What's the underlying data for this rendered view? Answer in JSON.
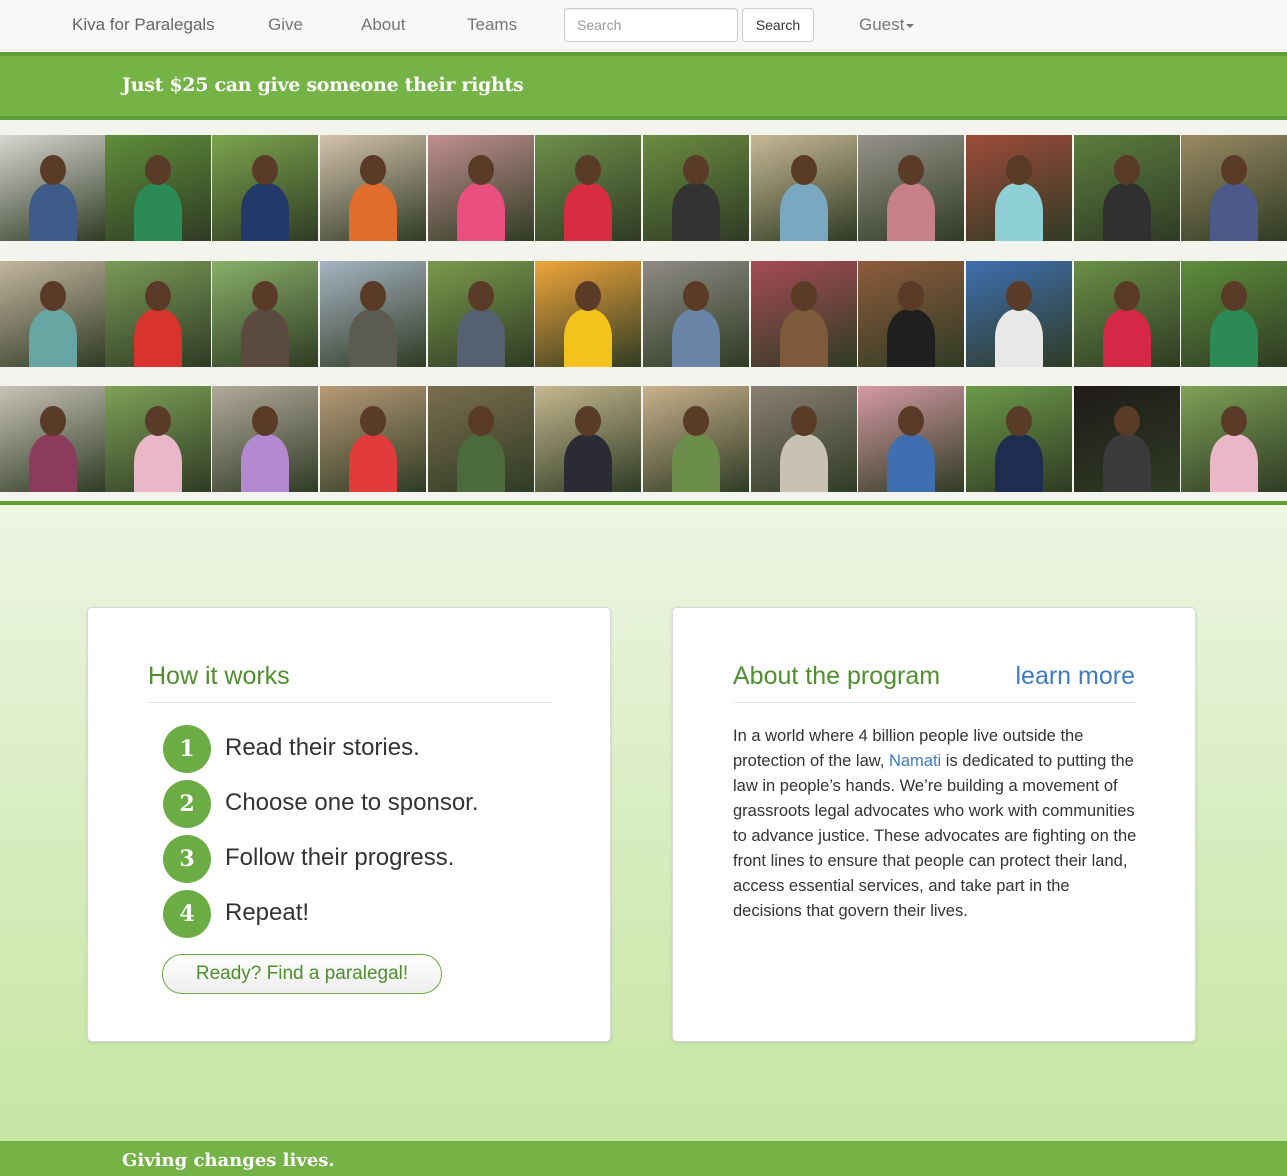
{
  "nav": {
    "brand": "Kiva for Paralegals",
    "links": [
      "Give",
      "About",
      "Teams"
    ],
    "search_placeholder": "Search",
    "search_button": "Search",
    "user_menu": "Guest"
  },
  "banner": {
    "text": "Just $25 can give someone their rights"
  },
  "photo_rows": [
    [
      {
        "bg": "#d8d7d1",
        "clothes": "#3f5b8a",
        "icon": "person-icon"
      },
      {
        "bg": "#5f8e3a",
        "clothes": "#2c8a55",
        "icon": "person-icon"
      },
      {
        "bg": "#7ca54d",
        "clothes": "#223a6a",
        "icon": "person-icon"
      },
      {
        "bg": "#d4c2ae",
        "clothes": "#e06d2b",
        "icon": "person-icon"
      },
      {
        "bg": "#c18f8e",
        "clothes": "#e9507f",
        "icon": "person-icon"
      },
      {
        "bg": "#6f8f4b",
        "clothes": "#d82d40",
        "icon": "person-icon"
      },
      {
        "bg": "#6b8c41",
        "clothes": "#333333",
        "icon": "person-icon"
      },
      {
        "bg": "#c8b995",
        "clothes": "#7aa8c0",
        "icon": "person-icon"
      },
      {
        "bg": "#97938a",
        "clothes": "#c77f8a",
        "icon": "person-icon"
      },
      {
        "bg": "#9e4b3a",
        "clothes": "#8fd0d6",
        "icon": "person-icon"
      },
      {
        "bg": "#5c7d3e",
        "clothes": "#303030",
        "icon": "person-icon"
      },
      {
        "bg": "#9a8a63",
        "clothes": "#4b5a8a",
        "icon": "person-icon"
      }
    ],
    [
      {
        "bg": "#c3b5a0",
        "clothes": "#67a6a3",
        "icon": "person-icon"
      },
      {
        "bg": "#7a9b58",
        "clothes": "#d9332e",
        "icon": "person-icon"
      },
      {
        "bg": "#89b06a",
        "clothes": "#5b4b3f",
        "icon": "person-icon"
      },
      {
        "bg": "#a7b4c2",
        "clothes": "#5b5c4f",
        "icon": "person-icon"
      },
      {
        "bg": "#7a9a4c",
        "clothes": "#556070",
        "icon": "person-icon"
      },
      {
        "bg": "#f0a53b",
        "clothes": "#f3c21c",
        "icon": "person-icon"
      },
      {
        "bg": "#8f8b84",
        "clothes": "#6b85a8",
        "icon": "person-icon"
      },
      {
        "bg": "#a64b55",
        "clothes": "#7c5a3a",
        "icon": "person-icon"
      },
      {
        "bg": "#8e5b3c",
        "clothes": "#1f1f1f",
        "icon": "person-icon"
      },
      {
        "bg": "#3e6fb0",
        "clothes": "#e8e8e8",
        "icon": "person-icon"
      },
      {
        "bg": "#6a8f47",
        "clothes": "#d62846",
        "icon": "person-icon"
      },
      {
        "bg": "#5e8f3c",
        "clothes": "#2c8a55",
        "icon": "person-icon"
      }
    ],
    [
      {
        "bg": "#c8c3b8",
        "clothes": "#8b3b5c",
        "icon": "person-icon"
      },
      {
        "bg": "#7ea257",
        "clothes": "#e9b7c8",
        "icon": "person-icon"
      },
      {
        "bg": "#b2aa9b",
        "clothes": "#b38ad0",
        "icon": "person-icon"
      },
      {
        "bg": "#b79a77",
        "clothes": "#e23b3b",
        "icon": "person-icon"
      },
      {
        "bg": "#7b6e4f",
        "clothes": "#4b6b3c",
        "icon": "person-icon"
      },
      {
        "bg": "#c5b88f",
        "clothes": "#2b2b36",
        "icon": "person-icon"
      },
      {
        "bg": "#c9b18c",
        "clothes": "#6b8f4b",
        "icon": "person-icon"
      },
      {
        "bg": "#8a7f74",
        "clothes": "#c8c2b5",
        "icon": "person-icon"
      },
      {
        "bg": "#d59aa4",
        "clothes": "#3f6fb0",
        "icon": "person-icon"
      },
      {
        "bg": "#6d9a49",
        "clothes": "#1f2e50",
        "icon": "person-icon"
      },
      {
        "bg": "#1f1a18",
        "clothes": "#3b3b3b",
        "icon": "person-icon"
      },
      {
        "bg": "#7ea257",
        "clothes": "#e9b7c8",
        "icon": "person-icon"
      }
    ]
  ],
  "how_it_works": {
    "title": "How it works",
    "steps": [
      {
        "num": "1",
        "text": "Read their stories."
      },
      {
        "num": "2",
        "text": "Choose one to sponsor."
      },
      {
        "num": "3",
        "text": "Follow their progress."
      },
      {
        "num": "4",
        "text": "Repeat!"
      }
    ],
    "button": "Ready? Find a paralegal!"
  },
  "about_program": {
    "title": "About the program",
    "learn_more": "learn more",
    "text_before_link": "In a world where 4 billion people live outside the protection of the law, ",
    "link_text": "Namati",
    "text_after_link": " is dedicated to putting the law in people’s hands. We’re building a movement of grassroots legal advocates who work with communities to advance justice. These advocates are fighting on the front lines to ensure that people can protect their land, access essential services, and take part in the decisions that govern their lives."
  },
  "footer": {
    "text": "Giving changes lives."
  },
  "colors": {
    "brand_green": "#76b347",
    "dark_green": "#5e9d35",
    "link_blue": "#3f7bc4"
  }
}
